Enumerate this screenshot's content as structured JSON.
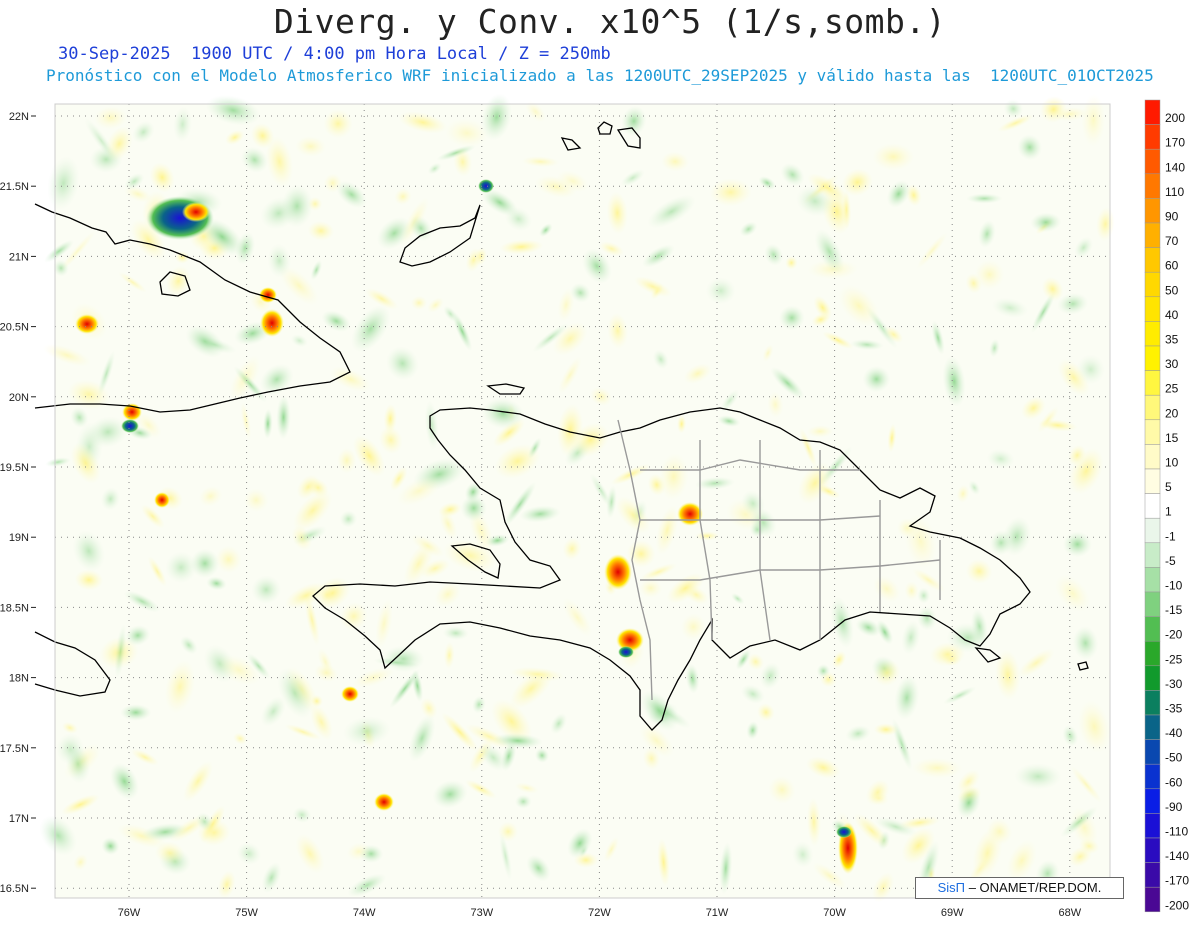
{
  "title": "Diverg. y Conv. x10^5 (1/s,somb.)",
  "subtitle_1": "30-Sep-2025  1900 UTC / 4:00 pm Hora Local / Z = 250mb",
  "subtitle_2": "Pronóstico con el Modelo Atmosferico WRF inicializado a las 1200UTC_29SEP2025 y válido hasta las  1200UTC_01OCT2025",
  "lat_labels": [
    "22N",
    "21.5N",
    "21N",
    "20.5N",
    "20N",
    "19.5N",
    "19N",
    "18.5N",
    "18N",
    "17.5N",
    "17N",
    "16.5N"
  ],
  "lon_labels": [
    "76W",
    "75W",
    "74W",
    "73W",
    "72W",
    "71W",
    "70W",
    "69W",
    "68W"
  ],
  "colorbar": {
    "levels": [
      "200",
      "170",
      "140",
      "110",
      "90",
      "70",
      "60",
      "50",
      "40",
      "35",
      "30",
      "25",
      "20",
      "15",
      "10",
      "5",
      "1",
      "-1",
      "-5",
      "-10",
      "-15",
      "-20",
      "-25",
      "-30",
      "-35",
      "-40",
      "-50",
      "-60",
      "-90",
      "-110",
      "-140",
      "-170",
      "-200"
    ],
    "colors": [
      "#ff1a00",
      "#ff3b00",
      "#ff5a00",
      "#ff7800",
      "#ff9600",
      "#ffb000",
      "#ffc800",
      "#ffd800",
      "#ffe400",
      "#ffec00",
      "#fff200",
      "#fff640",
      "#fff87a",
      "#fffaa8",
      "#fffbc8",
      "#fffde2",
      "#ffffff",
      "#eaf6ea",
      "#c8ecc8",
      "#a6e0a6",
      "#7fd17f",
      "#52be52",
      "#2aa82a",
      "#119a2c",
      "#0b7f5f",
      "#0a6488",
      "#0a48b0",
      "#0a32d0",
      "#0a1ee6",
      "#1a10d6",
      "#2a0cc0",
      "#3a0aa8",
      "#4a0894"
    ]
  },
  "credit": {
    "brand": "SisΠ",
    "text": " – ONAMET/REP.DOM."
  }
}
